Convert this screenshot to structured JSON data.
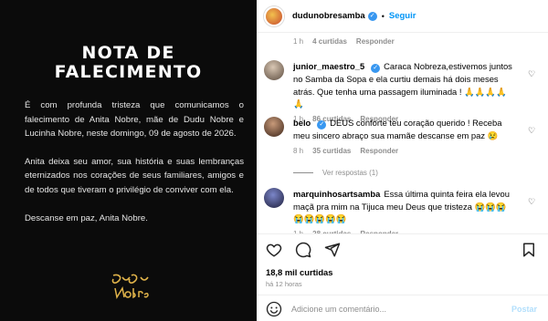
{
  "image": {
    "title_line1": "NOTA DE",
    "title_line2": "FALECIMENTO",
    "para1": "É com profunda tristeza que comunicamos o falecimento de Anita Nobre, mãe de Dudu Nobre e Lucinha Nobre, neste domingo, 09 de agosto de 2026.",
    "para2": "Anita deixa seu amor, sua história e suas lembranças eternizados nos corações de seus familiares, amigos e de todos que tiveram o privilégio de conviver com ela.",
    "para3": "Descanse em paz, Anita Nobre.",
    "signature_text": "Dudu Nobre"
  },
  "header": {
    "username": "dudunobresamba",
    "separator": "•",
    "follow_label": "Seguir"
  },
  "top_meta": {
    "time": "1 h",
    "likes": "4 curtidas",
    "reply": "Responder"
  },
  "comments": [
    {
      "user": "junior_maestro_5",
      "text": "Caraca Nobreza,estivemos juntos no Samba da Sopa e ela curtiu demais há dois meses atrás. Que tenha uma passagem iluminada ! 🙏🙏🙏🙏🙏",
      "time": "1 h",
      "likes": "86 curtidas",
      "reply": "Responder"
    },
    {
      "user": "belo",
      "text": "DEUS conforte teu coração querido ! Receba meu sincero abraço sua mamãe descanse em paz 😢",
      "time": "8 h",
      "likes": "35 curtidas",
      "reply": "Responder"
    },
    {
      "user": "marquinhosartsamba",
      "text": "Essa última quinta feira ela levou maçã pra mim na Tijuca meu Deus que tristeza 😭😭😭😭😭😭😭😭",
      "time": "1 h",
      "likes": "28 curtidas",
      "reply": "Responder"
    }
  ],
  "view_replies": "Ver respostas (1)",
  "actions": {
    "likes": "18,8 mil curtidas",
    "posted_ago": "há 12 horas",
    "comment_placeholder": "Adicione um comentário...",
    "post_label": "Postar"
  },
  "colors": {
    "accent": "#0095f6",
    "verified": "#3897f0",
    "muted": "#8e8e8e"
  }
}
